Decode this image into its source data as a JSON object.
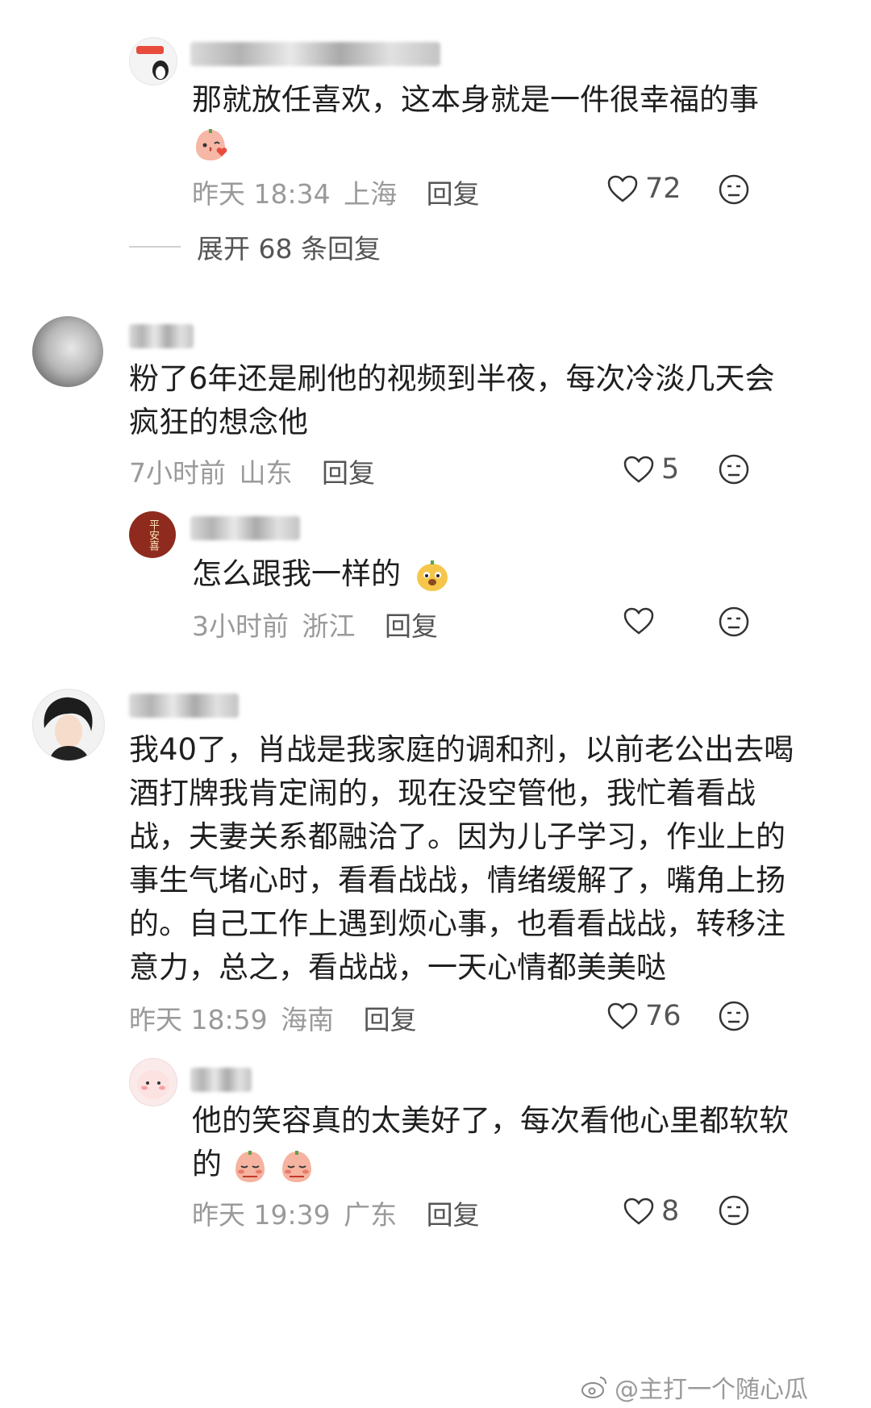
{
  "comments": [
    {
      "text": "那就放任喜欢，这本身就是一件很幸福的事",
      "time": "昨天 18:34",
      "location": "上海",
      "reply_label": "回复",
      "likes": "72",
      "expand_label": "展开 68 条回复"
    },
    {
      "text_line1": "粉了6年还是刷他的视频到半夜，每次冷淡几天会",
      "text_line2": "疯狂的想念他",
      "time": "7小时前",
      "location": "山东",
      "reply_label": "回复",
      "likes": "5"
    },
    {
      "text": "怎么跟我一样的",
      "time": "3小时前",
      "location": "浙江",
      "reply_label": "回复",
      "avatar_text": "平安喜"
    },
    {
      "text_line1": "我40了，肖战是我家庭的调和剂，以前老公出去喝",
      "text_line2": "酒打牌我肯定闹的，现在没空管他，我忙着看战",
      "text_line3": "战，夫妻关系都融洽了。因为儿子学习，作业上的",
      "text_line4": "事生气堵心时，看看战战，情绪缓解了，嘴角上扬",
      "text_line5": "的。自己工作上遇到烦心事，也看看战战，转移注",
      "text_line6": "意力，总之，看战战，一天心情都美美哒",
      "time": "昨天 18:59",
      "location": "海南",
      "reply_label": "回复",
      "likes": "76"
    },
    {
      "text_line1": "他的笑容真的太美好了，每次看他心里都软软",
      "text_line2": "的",
      "time": "昨天 19:39",
      "location": "广东",
      "reply_label": "回复",
      "likes": "8"
    }
  ],
  "watermark": "@主打一个随心瓜"
}
